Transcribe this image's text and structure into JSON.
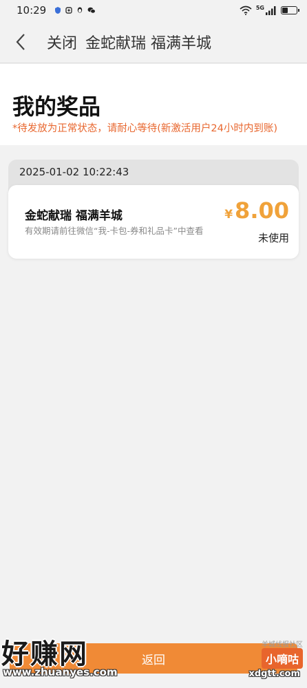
{
  "status_bar": {
    "time": "10:29",
    "network": "5G",
    "icons": [
      "shield-icon",
      "app-icon",
      "qq-icon",
      "wechat-icon",
      "wifi-icon",
      "signal-icon",
      "battery-icon"
    ]
  },
  "nav": {
    "close_label": "关闭",
    "title": "金蛇献瑞 福满羊城"
  },
  "header": {
    "title": "我的奖品",
    "notice": "*待发放为正常状态，请耐心等待(新激活用户24小时内到账)"
  },
  "prizes": [
    {
      "date": "2025-01-02 10:22:43",
      "name": "金蛇献瑞 福满羊城",
      "description": "有效期请前往微信“我-卡包-券和礼品卡”中查看",
      "currency": "¥",
      "amount": "8.00",
      "status": "未使用"
    }
  ],
  "bottom": {
    "button_label": "返回"
  },
  "watermarks": {
    "left_text": "好赚网",
    "left_url": "www.zhuanyes.com",
    "right_tag": "羊城线报社区",
    "right_badge": "小嘀咕",
    "right_site": "xdgtt.com"
  },
  "colors": {
    "accent_orange": "#f08a36",
    "amount_color": "#f0a23a",
    "notice_color": "#e8672f"
  }
}
